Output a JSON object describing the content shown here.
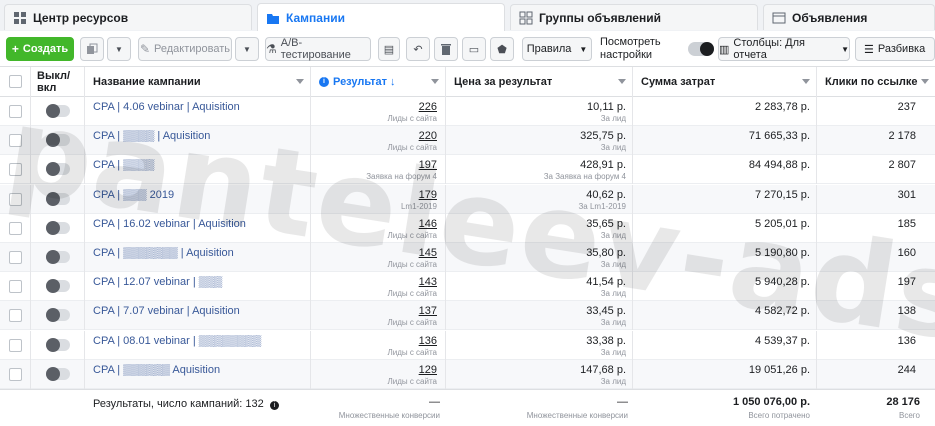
{
  "tabs": [
    {
      "label": "Центр ресурсов",
      "icon": "grid-icon"
    },
    {
      "label": "Кампании",
      "icon": "folder-icon"
    },
    {
      "label": "Группы объявлений",
      "icon": "grid-icon"
    },
    {
      "label": "Объявления",
      "icon": "ad-icon"
    }
  ],
  "toolbar": {
    "create_label": "Создать",
    "edit_label": "Редактировать",
    "ab_label": "A/B-тестирование",
    "rules_label": "Правила",
    "view_settings_label": "Посмотреть настройки",
    "columns_label": "Столбцы: Для отчета",
    "breakdown_label": "Разбивка"
  },
  "columns": {
    "onoff": "Выкл/ вкл",
    "name": "Название кампании",
    "result": "Результат",
    "cpr": "Цена за результат",
    "spend": "Сумма затрат",
    "clicks": "Клики по ссылке"
  },
  "rows": [
    {
      "name": "CPA | 4.06 vebinar | Aquisition",
      "result": "226",
      "result_type": "Лиды с сайта",
      "cpr": "10,11 р.",
      "cpr_type": "За лид",
      "spend": "2 283,78 р.",
      "clicks": "237"
    },
    {
      "name": "CPA | ▒▒▒▒ | Aquisition",
      "result": "220",
      "result_type": "Лиды с сайта",
      "cpr": "325,75 р.",
      "cpr_type": "За лид",
      "spend": "71 665,33 р.",
      "clicks": "2 178"
    },
    {
      "name": "CPA | ▒▒▒▒",
      "result": "197",
      "result_type": "Заявка на форум 4",
      "cpr": "428,91 р.",
      "cpr_type": "За Заявка на форум 4",
      "spend": "84 494,88 р.",
      "clicks": "2 807"
    },
    {
      "name": "CPA | ▒▒▒ 2019",
      "result": "179",
      "result_type": "Lm1-2019",
      "cpr": "40,62 р.",
      "cpr_type": "За Lm1-2019",
      "spend": "7 270,15 р.",
      "clicks": "301"
    },
    {
      "name": "CPA | 16.02 vebinar | Aquisition",
      "result": "146",
      "result_type": "Лиды с сайта",
      "cpr": "35,65 р.",
      "cpr_type": "За лид",
      "spend": "5 205,01 р.",
      "clicks": "185"
    },
    {
      "name": "CPA | ▒▒▒▒▒▒▒ | Aquisition",
      "result": "145",
      "result_type": "Лиды с сайта",
      "cpr": "35,80 р.",
      "cpr_type": "За лид",
      "spend": "5 190,80 р.",
      "clicks": "160"
    },
    {
      "name": "CPA | 12.07 vebinar | ▒▒▒",
      "result": "143",
      "result_type": "Лиды с сайта",
      "cpr": "41,54 р.",
      "cpr_type": "За лид",
      "spend": "5 940,28 р.",
      "clicks": "197"
    },
    {
      "name": "CPA | 7.07 vebinar | Aquisition",
      "result": "137",
      "result_type": "Лиды с сайта",
      "cpr": "33,45 р.",
      "cpr_type": "За лид",
      "spend": "4 582,72 р.",
      "clicks": "138"
    },
    {
      "name": "CPA | 08.01 vebinar | ▒▒▒▒▒▒▒▒",
      "result": "136",
      "result_type": "Лиды с сайта",
      "cpr": "33,38 р.",
      "cpr_type": "За лид",
      "spend": "4 539,37 р.",
      "clicks": "136"
    },
    {
      "name": "CPA | ▒▒▒▒▒▒ Aquisition",
      "result": "129",
      "result_type": "Лиды с сайта",
      "cpr": "147,68 р.",
      "cpr_type": "За лид",
      "spend": "19 051,26 р.",
      "clicks": "244"
    }
  ],
  "footer": {
    "summary": "Результаты, число кампаний: 132",
    "result_dash": "—",
    "result_sub": "Множественные конверсии",
    "cpr_dash": "—",
    "cpr_sub": "Множественные конверсии",
    "spend_total": "1 050 076,00 р.",
    "spend_sub": "Всего потрачено",
    "clicks_total": "28 176",
    "clicks_sub": "Всего"
  },
  "watermark": "panteleev-ads.ru",
  "colors": {
    "accent": "#1877f2",
    "create": "#42b72a",
    "link": "#385898"
  }
}
